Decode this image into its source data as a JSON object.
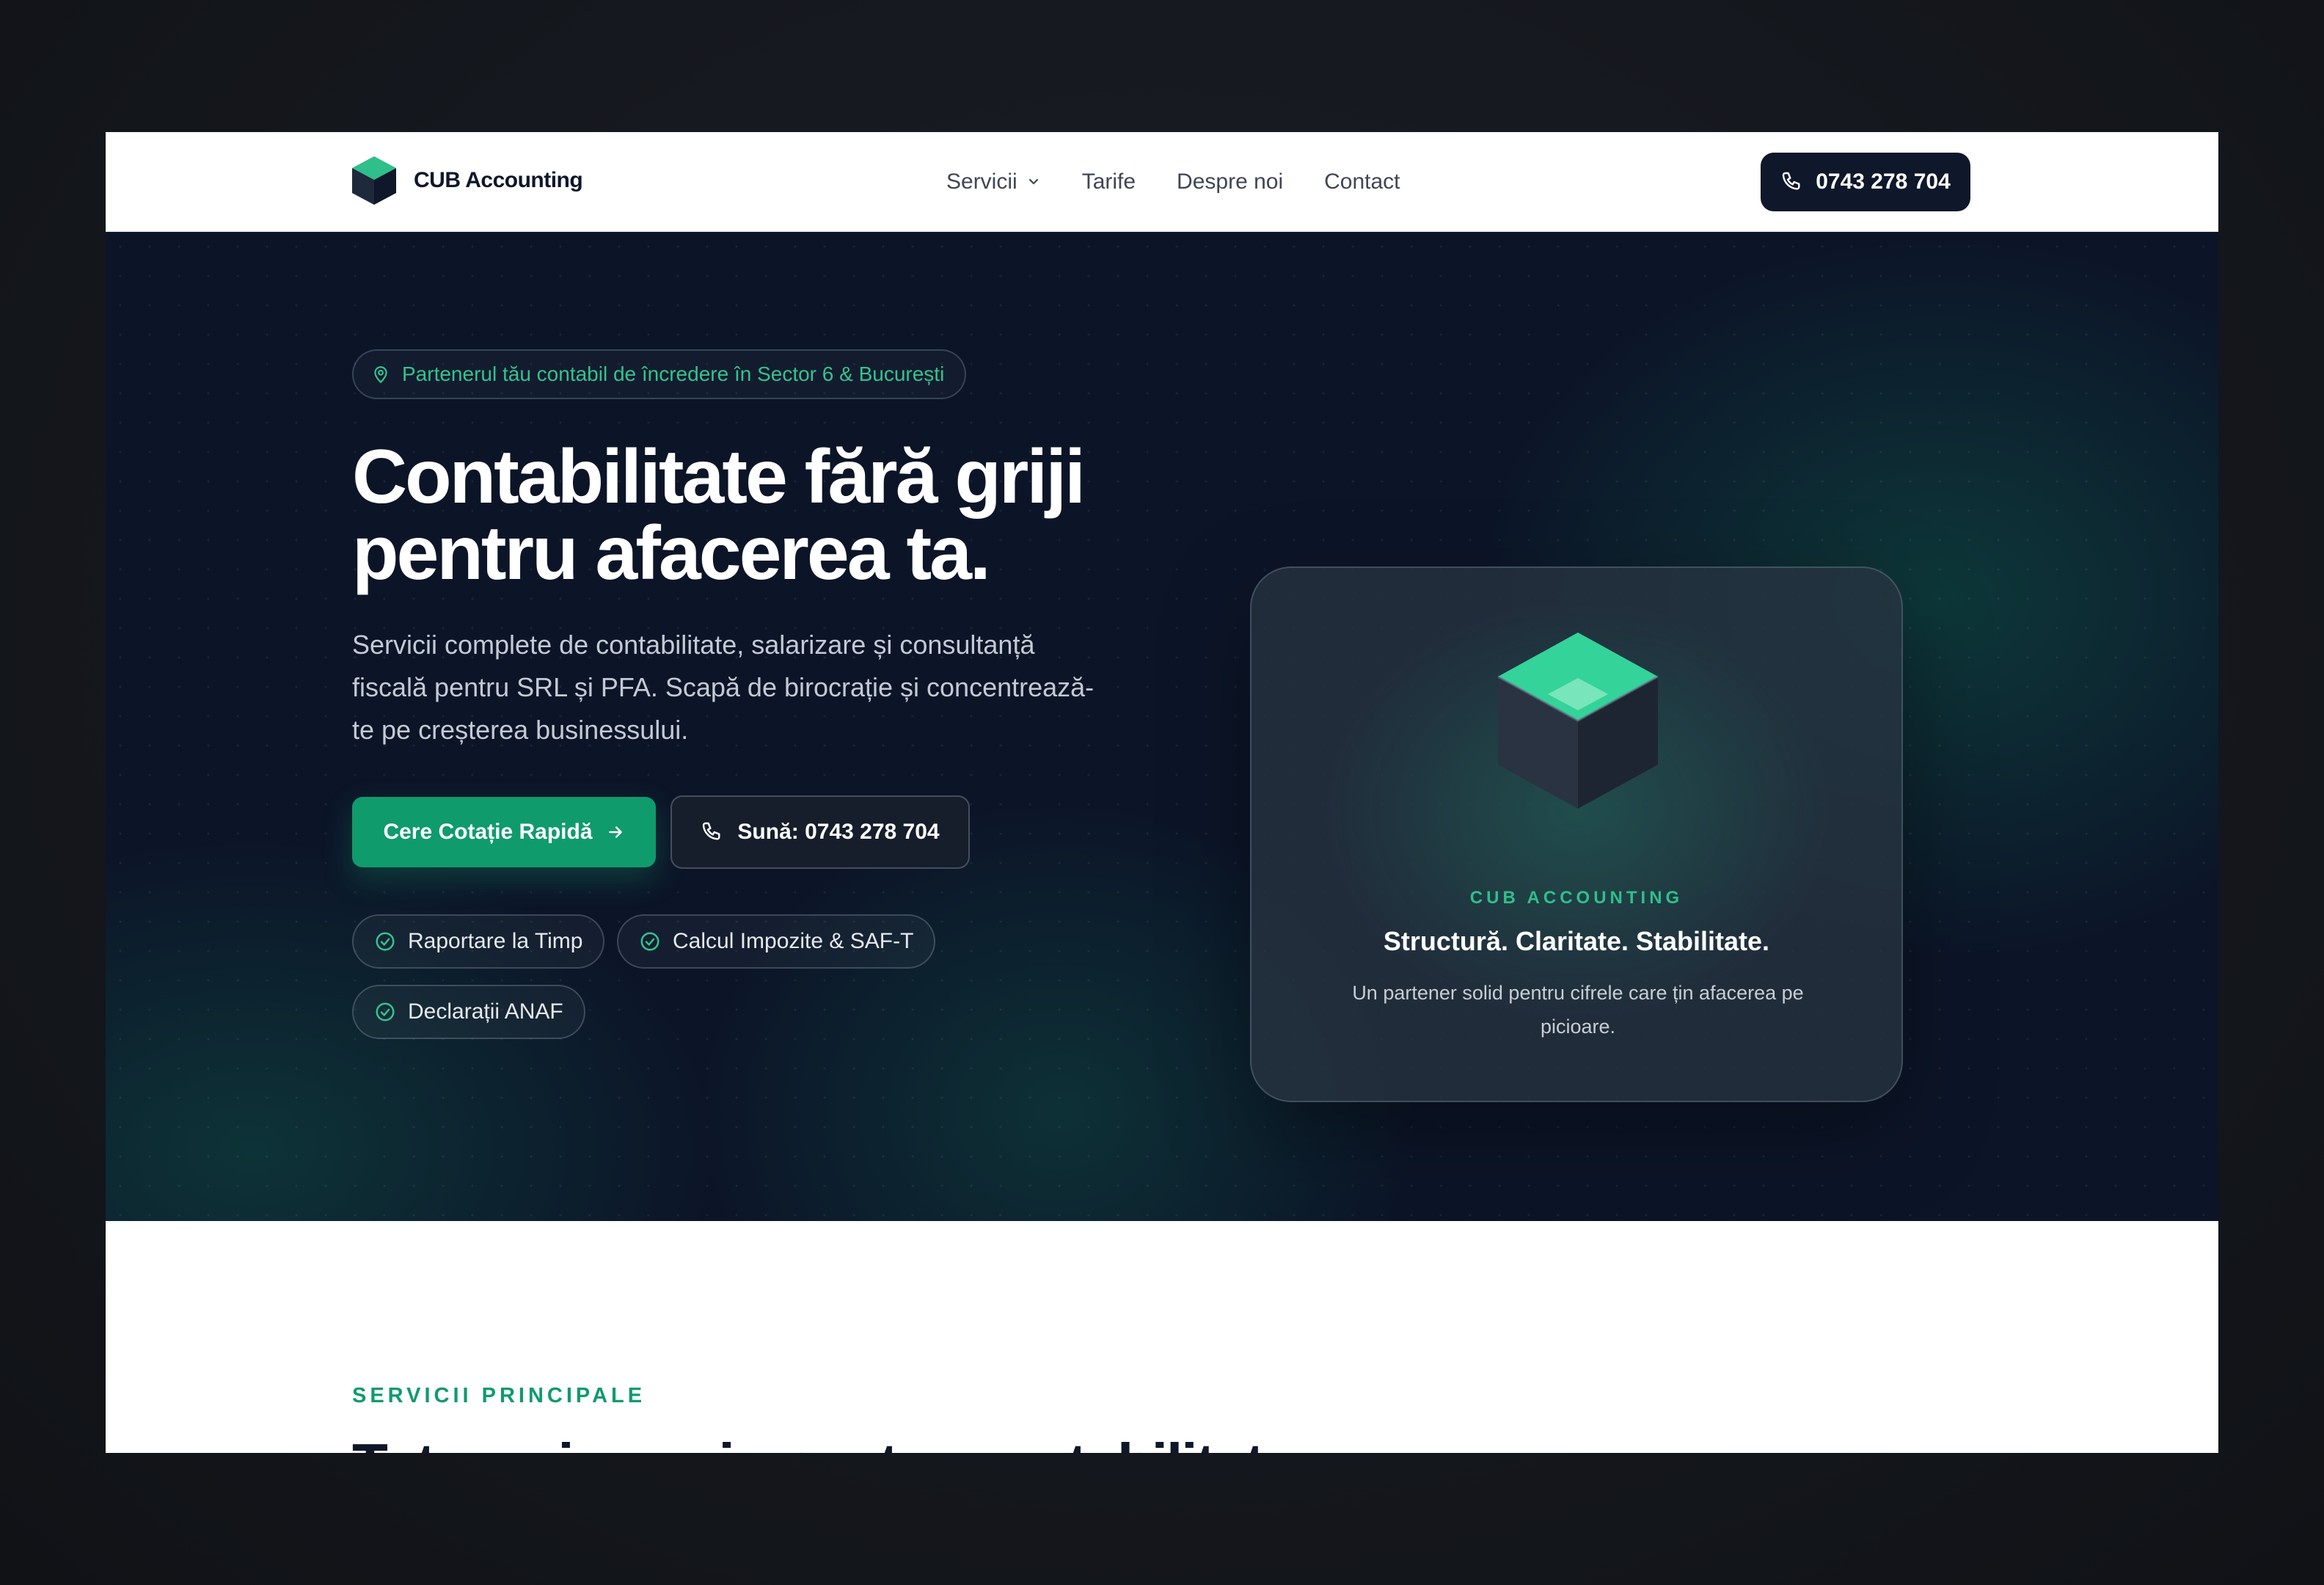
{
  "brand": {
    "name": "CUB Accounting"
  },
  "nav": {
    "links": [
      {
        "label": "Servicii",
        "has_dropdown": true
      },
      {
        "label": "Tarife"
      },
      {
        "label": "Despre noi"
      },
      {
        "label": "Contact"
      }
    ],
    "phone_label": "0743 278 704"
  },
  "hero": {
    "badge": "Partenerul tău contabil de încredere în Sector 6 & București",
    "headline_line1": "Contabilitate fără griji",
    "headline_line2": "pentru afacerea ta.",
    "subtitle": "Servicii complete de contabilitate, salarizare și consultanță fiscală pentru SRL și PFA. Scapă de birocrație și concentrează-te pe creșterea businessului.",
    "cta_primary": "Cere Cotație Rapidă",
    "cta_secondary": "Sună: 0743 278 704",
    "features": [
      "Raportare la Timp",
      "Calcul Impozite & SAF-T",
      "Declarații ANAF"
    ]
  },
  "card": {
    "eyebrow": "CUB ACCOUNTING",
    "title": "Structură. Claritate. Stabilitate.",
    "text": "Un partener solid pentru cifrele care țin afacerea pe picioare."
  },
  "services": {
    "eyebrow": "SERVICII PRINCIPALE",
    "title": "Tot ce ai nevoie pentru contabilitate"
  },
  "colors": {
    "brand_green": "#109b6c",
    "accent_green": "#34c38f",
    "navy": "#0f172a",
    "hero_bg": "#0c1528"
  },
  "icons": [
    "cube-logo-icon",
    "chevron-down-icon",
    "phone-icon",
    "map-pin-icon",
    "arrow-right-icon",
    "check-circle-icon"
  ]
}
